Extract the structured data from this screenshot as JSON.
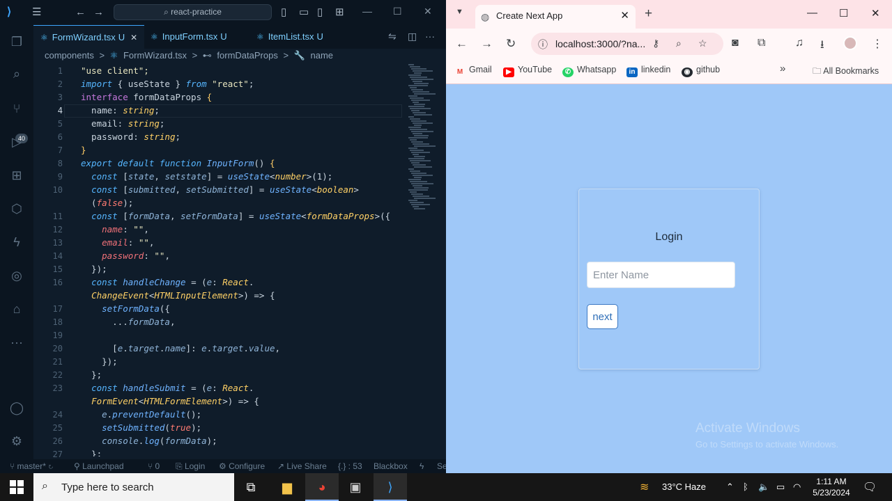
{
  "vscode": {
    "search_placeholder": "react-practice",
    "badge": "40",
    "tabs": [
      {
        "label": "FormWizard.tsx",
        "status": "U"
      },
      {
        "label": "InputForm.tsx",
        "status": "U"
      },
      {
        "label": "ItemList.tsx",
        "status": "U"
      }
    ],
    "breadcrumb": [
      "components",
      ">",
      "FormWizard.tsx",
      ">",
      "formDataProps",
      ">",
      "name"
    ],
    "line_numbers": [
      "1",
      "2",
      "3",
      "4",
      "5",
      "6",
      "7",
      "8",
      "9",
      "10",
      "",
      "11",
      "12",
      "13",
      "14",
      "15",
      "16",
      "",
      "17",
      "18",
      "19",
      "20",
      "21",
      "22",
      "23",
      "",
      "24",
      "25",
      "26",
      "27"
    ],
    "status": {
      "branch": "master*",
      "launchpad": "Launchpad",
      "ports": "0",
      "login": "Login",
      "configure": "Configure",
      "liveshare": "Live Share",
      "position": "{.} : 53",
      "blackbox": "Blackbox",
      "se": "Se"
    }
  },
  "chrome": {
    "tab_title": "Create Next App",
    "url": "localhost:3000/?na...",
    "bookmarks": [
      "Gmail",
      "YouTube",
      "Whatsapp",
      "linkedin",
      "github"
    ],
    "all_bookmarks": "All Bookmarks",
    "page": {
      "title": "Login",
      "name_placeholder": "Enter Name",
      "next_label": "next",
      "watermark_title": "Activate Windows",
      "watermark_sub": "Go to Settings to activate Windows."
    }
  },
  "taskbar": {
    "search_placeholder": "Type here to search",
    "weather": "33°C  Haze",
    "time": "1:11 AM",
    "date": "5/23/2024"
  },
  "colors": {
    "page_bg": "#9fc8f8",
    "editor_bg": "#0f1c2a",
    "tab_strip": "#fde3e7",
    "accent": "#3ea6ff"
  }
}
